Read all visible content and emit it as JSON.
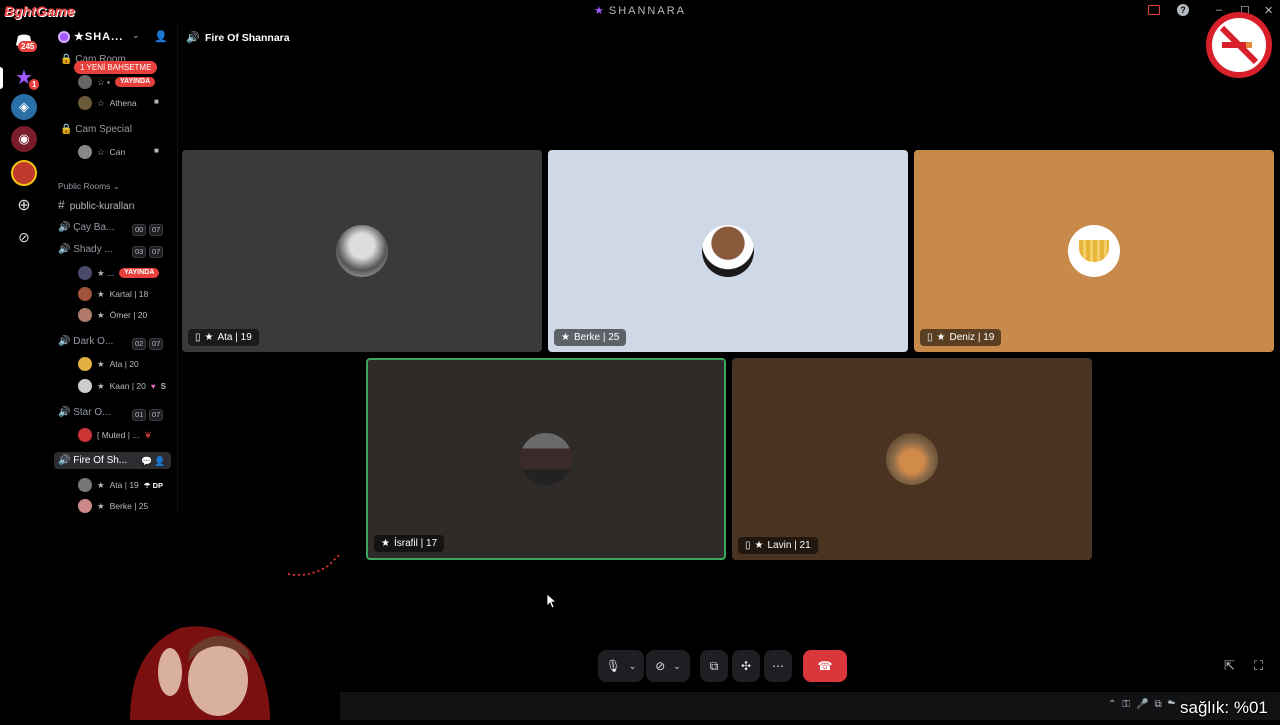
{
  "window": {
    "title": "SHANNARA",
    "minimize": "–",
    "maximize": "☐",
    "close": "✕"
  },
  "watermark": {
    "logo_text": "BghtGame",
    "health_text": "sağlık: %01"
  },
  "rail": {
    "dm_badge": "245",
    "server2_badge": "1"
  },
  "sidebar": {
    "server_name": "SHA...",
    "mention_pill": "1 YENİ BAHSETME",
    "sections": {
      "cam_room": "Cam Room",
      "cam_room_user1_live": "YAYINDA",
      "cam_room_user2": "Athena",
      "cam_special": "Cam Special",
      "cam_special_user": "Can",
      "public_rooms": "Public Rooms",
      "public_kurallari": "public-kuralları",
      "cay_bahcesi": "Çay Ba...",
      "cay_count_a": "00",
      "cay_count_b": "07",
      "shady": "Shady ...",
      "shady_count_a": "03",
      "shady_count_b": "07",
      "shady_user1_live": "YAYINDA",
      "shady_user2": "Kartal | 18",
      "shady_user3": "Ömer | 20",
      "dark": "Dark O...",
      "dark_count_a": "02",
      "dark_count_b": "07",
      "dark_user1": "Ata | 20",
      "dark_user2": "Kaan | 20",
      "star": "Star O...",
      "star_count_a": "01",
      "star_count_b": "07",
      "star_user1": "[ Muted | ...",
      "fire": "Fire Of Sh...",
      "fire_user1": "Ata | 19",
      "fire_user1_tag": "DP",
      "fire_user2": "Berke | 25"
    }
  },
  "header": {
    "channel_name": "Fire Of Shannara"
  },
  "tiles": [
    {
      "label": "Ata | 19",
      "bg": "#3a3a3a",
      "mobile": true
    },
    {
      "label": "Berke | 25",
      "bg": "#cfd8e6",
      "mobile": false
    },
    {
      "label": "Deniz | 19",
      "bg": "#c88a4a",
      "mobile": true
    },
    {
      "label": "İsrafil | 17",
      "bg": "#2f2b29",
      "mobile": false,
      "speaking": true
    },
    {
      "label": "Lavin | 21",
      "bg": "#4a3320",
      "mobile": true
    }
  ],
  "colors": {
    "accent": "#a259ff",
    "speaking_border": "#3ba55c",
    "end_call": "#da373c",
    "live_badge": "#e8413d"
  }
}
